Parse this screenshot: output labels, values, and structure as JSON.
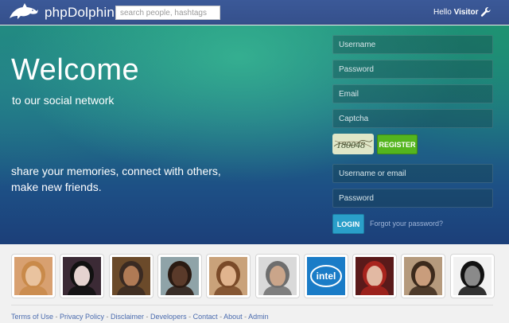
{
  "header": {
    "logo_text": "phpDolphin",
    "search_placeholder": "search people, hashtags",
    "greeting": "Hello",
    "username": "Visitor"
  },
  "hero": {
    "title": "Welcome",
    "subtitle": "to our social network",
    "tagline": "share your memories, connect with others, make new friends."
  },
  "register_form": {
    "username_placeholder": "Username",
    "password_placeholder": "Password",
    "email_placeholder": "Email",
    "captcha_placeholder": "Captcha",
    "captcha_code": "180048",
    "register_label": "REGISTER"
  },
  "login_form": {
    "username_placeholder": "Username or email",
    "password_placeholder": "Password",
    "login_label": "LOGIN",
    "forgot_label": "Forgot your password?"
  },
  "members": [
    {
      "name": "member-1",
      "bg": "#d8a070",
      "face": "#e9c39f",
      "hair": "#c98a4a"
    },
    {
      "name": "member-2",
      "bg": "#3b2a35",
      "face": "#e5d3d0",
      "hair": "#111111"
    },
    {
      "name": "member-3",
      "bg": "#6b4a2a",
      "face": "#b07a55",
      "hair": "#3a2a22"
    },
    {
      "name": "member-4",
      "bg": "#8fa3a8",
      "face": "#5a3a2a",
      "hair": "#2a1a12"
    },
    {
      "name": "member-5",
      "bg": "#c9a27a",
      "face": "#e1b48e",
      "hair": "#7a4a28"
    },
    {
      "name": "member-6",
      "bg": "#d9d9d9",
      "face": "#caa58a",
      "hair": "#6e6e6e"
    },
    {
      "name": "member-7",
      "bg": "#1a7cc7",
      "face": "",
      "hair": "",
      "logo": "intel"
    },
    {
      "name": "member-8",
      "bg": "#5a1a1a",
      "face": "#e2b9a3",
      "hair": "#a8241d"
    },
    {
      "name": "member-9",
      "bg": "#b59a7d",
      "face": "#c99d7c",
      "hair": "#3c2a1c"
    },
    {
      "name": "member-10",
      "bg": "#f2f2f2",
      "face": "#8a8a8a",
      "hair": "#111111"
    }
  ],
  "footer": {
    "links": [
      "Terms of Use",
      "Privacy Policy",
      "Disclaimer",
      "Developers",
      "Contact",
      "About",
      "Admin"
    ],
    "separator": " - "
  },
  "colors": {
    "header_bg": "#3b5998",
    "register_button": "#54b51e",
    "login_button": "#2a9fc9",
    "link": "#4a6bae"
  },
  "icons": {
    "logo": "dolphin-icon",
    "settings": "wrench-icon"
  }
}
